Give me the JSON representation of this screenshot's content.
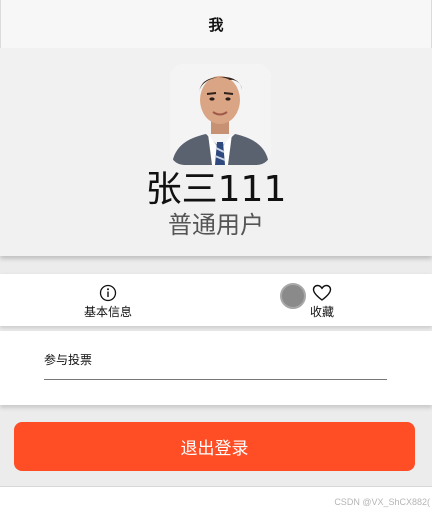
{
  "header": {
    "title": "我"
  },
  "profile": {
    "name": "张三111",
    "role": "普通用户"
  },
  "menu": {
    "items": [
      {
        "label": "基本信息",
        "icon": "info-icon"
      },
      {
        "label": "收藏",
        "icon": "heart-icon"
      }
    ]
  },
  "vote": {
    "label": "参与投票"
  },
  "logout": {
    "label": "退出登录"
  },
  "watermark": "CSDN @VX_ShCX882(",
  "colors": {
    "accent": "#ff4d25",
    "nav_bg": "#f7f7f7",
    "profile_bg": "#f1f1f1"
  }
}
